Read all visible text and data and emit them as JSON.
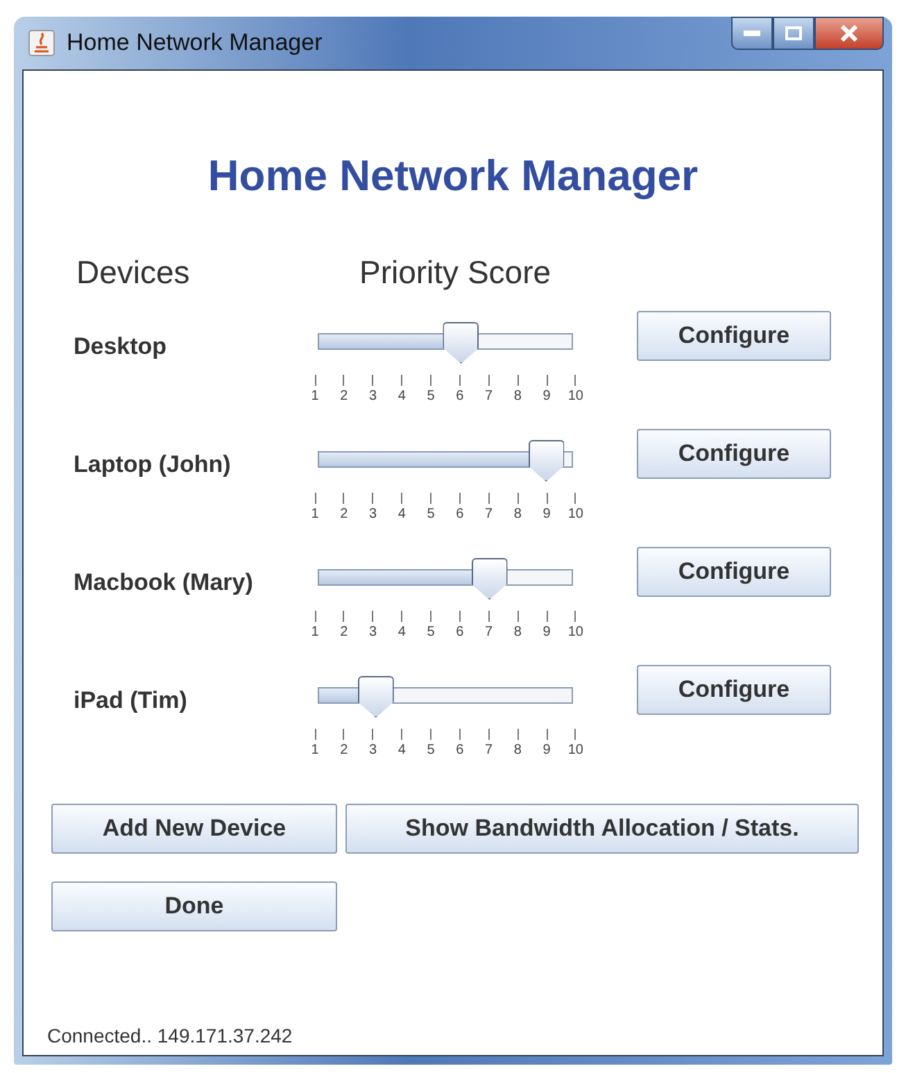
{
  "window": {
    "title": "Home Network Manager"
  },
  "heading": "Home Network Manager",
  "columns": [
    "Devices",
    "Priority Score"
  ],
  "devices": [
    {
      "name": "Desktop",
      "level": 0.556,
      "ticks": [
        "1",
        "2",
        "3",
        "4",
        "5",
        "6",
        "7",
        "8",
        "9",
        "10"
      ],
      "button": "Configure"
    },
    {
      "name": "Laptop (John)",
      "level": 0.889,
      "ticks": [
        "1",
        "2",
        "3",
        "4",
        "5",
        "6",
        "7",
        "8",
        "9",
        "10"
      ],
      "button": "Configure"
    },
    {
      "name": "Macbook (Mary)",
      "level": 0.667,
      "ticks": [
        "1",
        "2",
        "3",
        "4",
        "5",
        "6",
        "7",
        "8",
        "9",
        "10"
      ],
      "button": "Configure"
    },
    {
      "name": "iPad (Tim)",
      "level": 0.222,
      "ticks": [
        "1",
        "2",
        "3",
        "4",
        "5",
        "6",
        "7",
        "8",
        "9",
        "10"
      ],
      "button": "Configure"
    }
  ],
  "actions": [
    "Add New Device",
    "Show Bandwidth Allocation / Stats.",
    "Done"
  ],
  "status_bar": "Connected.. 149.171.37.242"
}
